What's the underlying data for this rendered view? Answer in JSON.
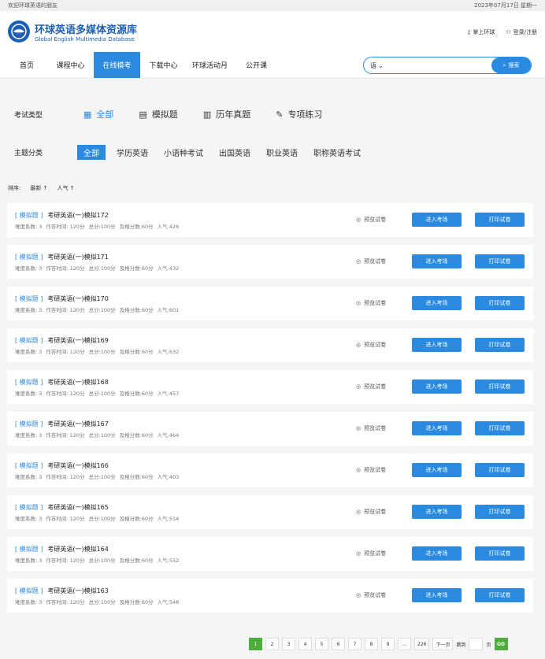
{
  "topbar": {
    "welcome": "欢迎环球英语的朋友",
    "date": "2023年07月17日 星期一"
  },
  "brand": {
    "name_cn": "环球英语多媒体资源库",
    "name_en": "Global English Multimedia Database"
  },
  "header": {
    "mobile_label": "掌上环球",
    "login_label": "登录/注册"
  },
  "nav": {
    "items": [
      "首页",
      "课程中心",
      "在线模考",
      "下载中心",
      "环球活动月",
      "公开课"
    ],
    "active_index": 2
  },
  "search": {
    "select_value": "语",
    "placeholder": "",
    "button_label": "搜索"
  },
  "filters": {
    "type_label": "考试类型",
    "types": [
      "全部",
      "模拟题",
      "历年真题",
      "专项练习"
    ],
    "subject_label": "主题分类",
    "subjects": [
      "全部",
      "学历英语",
      "小语种考试",
      "出国英语",
      "职业英语",
      "职称英语考试"
    ]
  },
  "sort": {
    "label": "排序:",
    "latest": "最新 ↑",
    "popular": "人气 ↑"
  },
  "card_labels": {
    "tag": "[ 模拟题 ]",
    "preview": "预览试卷",
    "enter": "进入考场",
    "print": "打印试卷"
  },
  "exams": [
    {
      "title": "考研英语(一)模拟172",
      "difficulty": "难度系数: 3",
      "time": "作答时间: 120分",
      "total": "总分:100分",
      "pass": "及格分数:60分",
      "popularity": "人气:426"
    },
    {
      "title": "考研英语(一)模拟171",
      "difficulty": "难度系数: 3",
      "time": "作答时间: 120分",
      "total": "总分:100分",
      "pass": "及格分数:60分",
      "popularity": "人气:432"
    },
    {
      "title": "考研英语(一)模拟170",
      "difficulty": "难度系数: 3",
      "time": "作答时间: 120分",
      "total": "总分:100分",
      "pass": "及格分数:60分",
      "popularity": "人气:601"
    },
    {
      "title": "考研英语(一)模拟169",
      "difficulty": "难度系数: 3",
      "time": "作答时间: 120分",
      "total": "总分:100分",
      "pass": "及格分数:60分",
      "popularity": "人气:632"
    },
    {
      "title": "考研英语(一)模拟168",
      "difficulty": "难度系数: 3",
      "time": "作答时间: 120分",
      "total": "总分:100分",
      "pass": "及格分数:60分",
      "popularity": "人气:457"
    },
    {
      "title": "考研英语(一)模拟167",
      "difficulty": "难度系数: 3",
      "time": "作答时间: 120分",
      "total": "总分:100分",
      "pass": "及格分数:60分",
      "popularity": "人气:464"
    },
    {
      "title": "考研英语(一)模拟166",
      "difficulty": "难度系数: 3",
      "time": "作答时间: 120分",
      "total": "总分:100分",
      "pass": "及格分数:60分",
      "popularity": "人气:403"
    },
    {
      "title": "考研英语(一)模拟165",
      "difficulty": "难度系数: 3",
      "time": "作答时间: 120分",
      "total": "总分:100分",
      "pass": "及格分数:60分",
      "popularity": "人气:514"
    },
    {
      "title": "考研英语(一)模拟164",
      "difficulty": "难度系数: 3",
      "time": "作答时间: 120分",
      "total": "总分:100分",
      "pass": "及格分数:60分",
      "popularity": "人气:552"
    },
    {
      "title": "考研英语(一)模拟163",
      "difficulty": "难度系数: 3",
      "time": "作答时间: 120分",
      "total": "总分:100分",
      "pass": "及格分数:60分",
      "popularity": "人气:548"
    }
  ],
  "pagination": {
    "pages": [
      "1",
      "2",
      "3",
      "4",
      "5",
      "6",
      "7",
      "8",
      "9",
      "...",
      "226"
    ],
    "current": "1",
    "next": "下一页",
    "goto_label": "跳到",
    "page_unit": "页",
    "go": "GO"
  },
  "colors": {
    "accent": "#2a8ae0",
    "brand": "#1d5fb3",
    "go_green": "#4cad3c"
  }
}
